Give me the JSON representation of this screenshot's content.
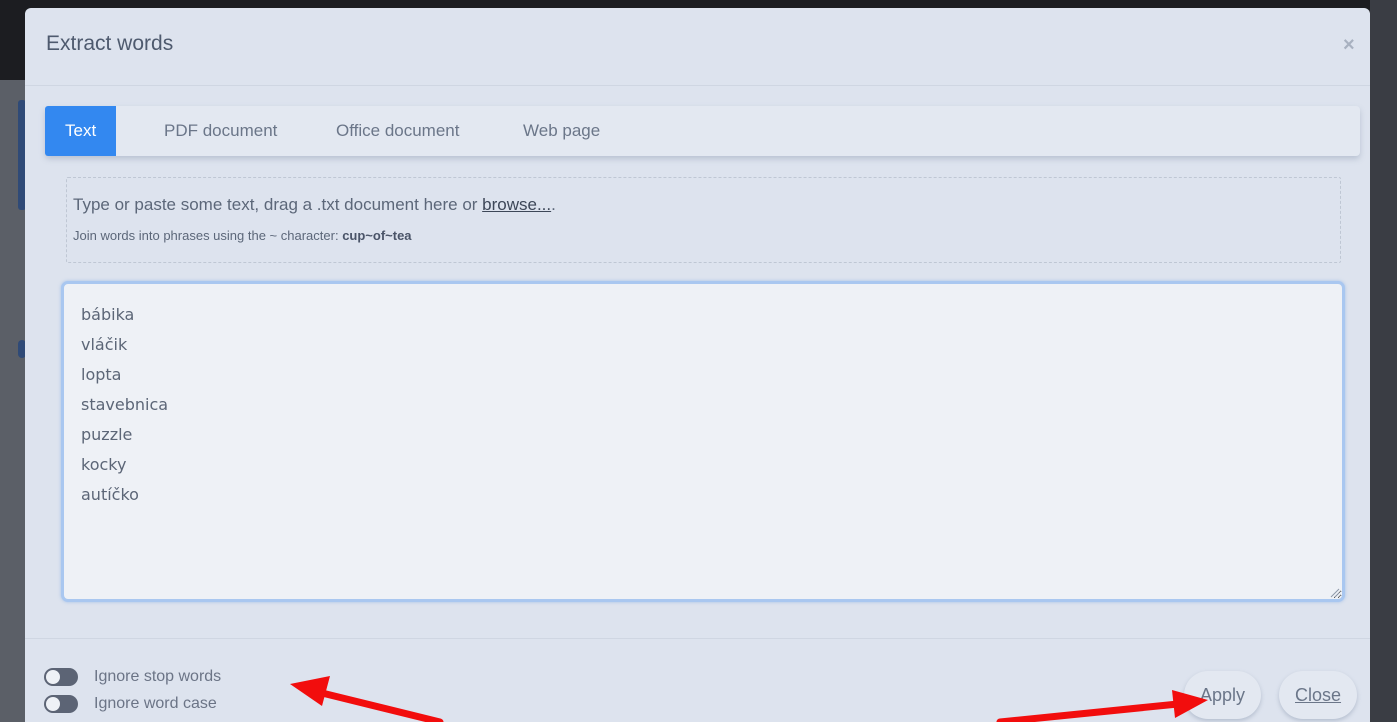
{
  "modal": {
    "title": "Extract words",
    "close_symbol": "×"
  },
  "tabs": [
    {
      "label": "Text",
      "active": true
    },
    {
      "label": "PDF document",
      "active": false
    },
    {
      "label": "Office document",
      "active": false
    },
    {
      "label": "Web page",
      "active": false
    }
  ],
  "drop_zone": {
    "text_before": "Type or paste some text, drag a .txt document here or ",
    "browse_link": "browse...",
    "text_after": ".",
    "hint_prefix": "Join words into phrases using the ~ character: ",
    "hint_example": "cup~of~tea"
  },
  "words_input": {
    "value": "bábika\nvláčik\nlopta\nstavebnica\npuzzle\nkocky\nautíčko"
  },
  "options": {
    "ignore_stop_words": {
      "label": "Ignore stop words",
      "enabled": false
    },
    "ignore_word_case": {
      "label": "Ignore word case",
      "enabled": false
    }
  },
  "footer": {
    "apply_label": "Apply",
    "close_label": "Close"
  },
  "colors": {
    "accent": "#3388f0",
    "annotation_arrow": "#f20d0d",
    "modal_background": "#dde3ee"
  }
}
